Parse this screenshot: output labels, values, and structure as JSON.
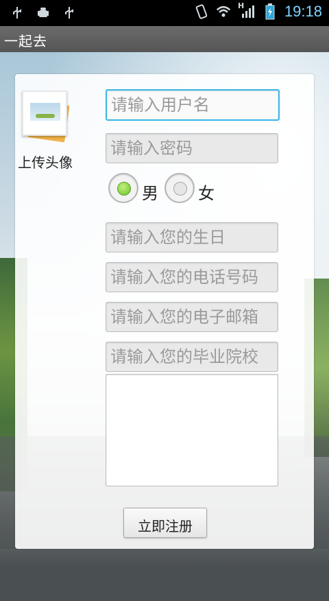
{
  "statusbar": {
    "icons_left": [
      "usb-icon",
      "android-debug-icon",
      "usb-icon"
    ],
    "icons_right": [
      "vibrate-icon",
      "wifi-icon",
      "hspa-signal-icon",
      "battery-charging-icon"
    ],
    "network_label": "H",
    "time": "19:18"
  },
  "titlebar": {
    "title": "一起去"
  },
  "avatar": {
    "label": "上传头像"
  },
  "form": {
    "username_placeholder": "请输入用户名",
    "password_placeholder": "请输入密码",
    "gender": {
      "male": "男",
      "female": "女",
      "selected": "男"
    },
    "birthday_placeholder": "请输入您的生日",
    "phone_placeholder": "请输入您的电话号码",
    "email_placeholder": "请输入您的电子邮箱",
    "school_placeholder": "请输入您的毕业院校"
  },
  "submit": {
    "label": "立即注册"
  },
  "colors": {
    "focus_border": "#39b5e8",
    "radio_checked": "#6cc32e",
    "time_text": "#7fd5ff"
  }
}
